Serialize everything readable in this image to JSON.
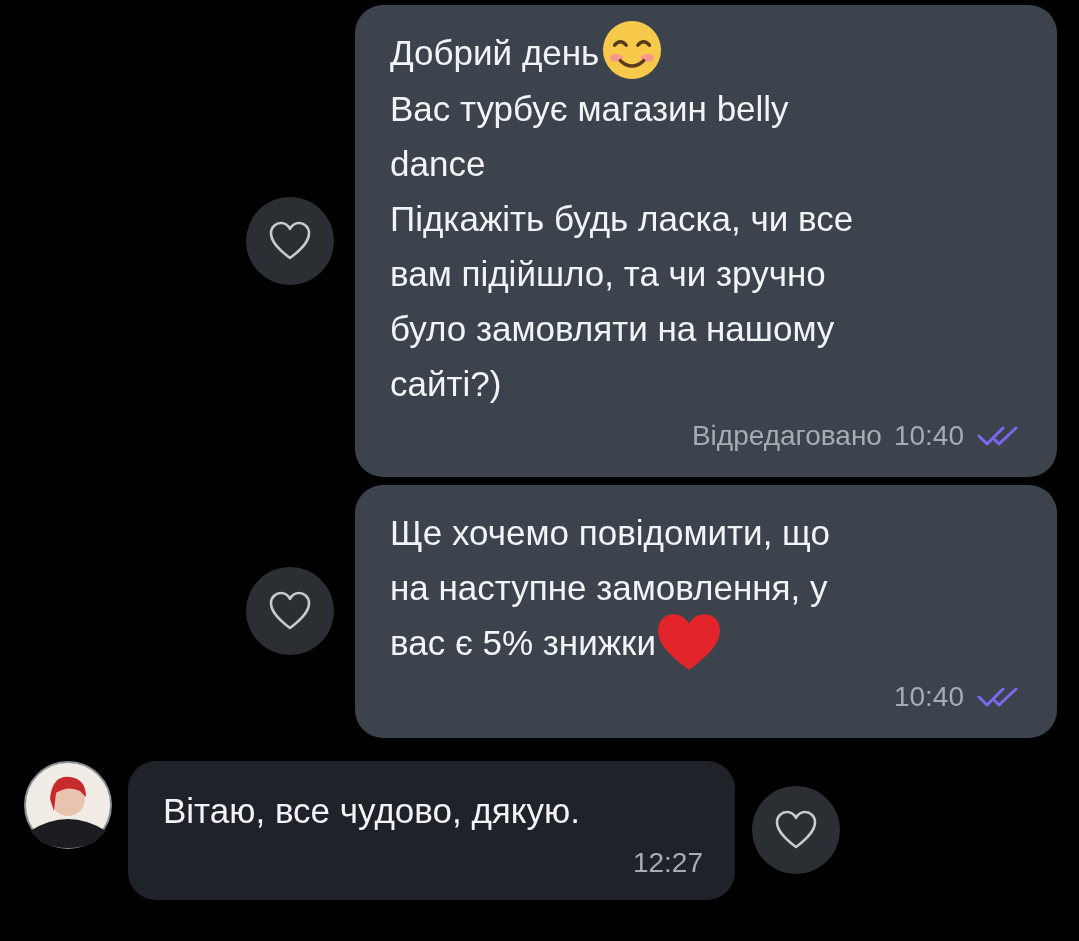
{
  "messages": [
    {
      "kind": "outgoing",
      "lines": [
        {
          "text": "Добрий день",
          "kind": "smile"
        },
        {
          "text": "Вас турбує магазин belly"
        },
        {
          "text": "dance"
        },
        {
          "text": "Підкажіть будь ласка, чи все"
        },
        {
          "text": "вам підійшло, та чи зручно"
        },
        {
          "text": "було замовляти на нашому"
        },
        {
          "text": "сайті?)"
        }
      ],
      "edited_label": "Відредаговано",
      "time": "10:40",
      "read": true,
      "liked": false
    },
    {
      "kind": "outgoing",
      "lines": [
        {
          "text": "Ще хочемо повідомити, що"
        },
        {
          "text": "на наступне замовлення, у"
        },
        {
          "text": "вас є 5% знижки",
          "kind": "heart"
        }
      ],
      "time": "10:40",
      "read": true,
      "liked": false
    },
    {
      "kind": "incoming",
      "lines": [
        {
          "text": "Вітаю, все чудово, дякую."
        }
      ],
      "time": "12:27",
      "liked": false
    }
  ]
}
